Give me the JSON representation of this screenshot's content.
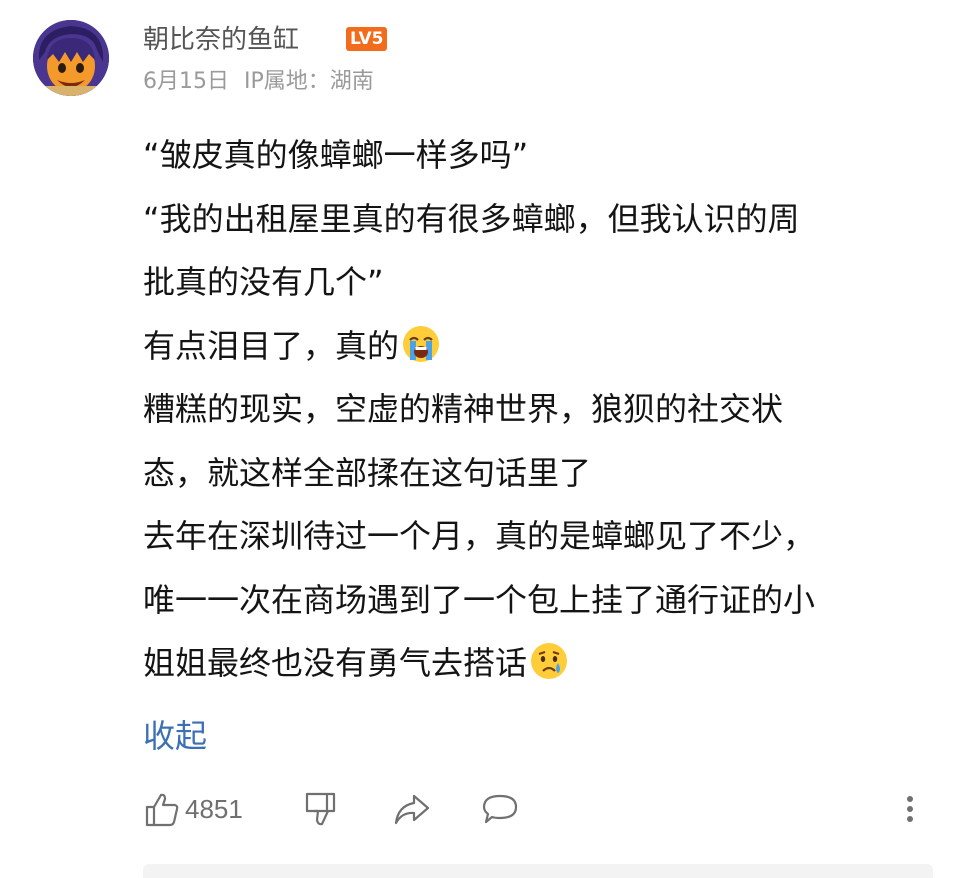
{
  "comment": {
    "user": {
      "name": "朝比奈的鱼缸",
      "level_badge": "LV5"
    },
    "meta": {
      "date": "6月15日",
      "ip_location": "IP属地：湖南"
    },
    "lines": [
      "“皱皮真的像蟑螂一样多吗”",
      "“我的出租屋里真的有很多蟑螂，但我认识的周",
      "批真的没有几个”",
      "有点泪目了，真的",
      "糟糕的现实，空虚的精神世界，狼狈的社交状",
      "态，就这样全部揉在这句话里了",
      "去年在深圳待过一个月，真的是蟑螂见了不少，",
      "唯一一次在商场遇到了一个包上挂了通行证的小",
      "姐姐最终也没有勇气去搭话"
    ],
    "emojis": {
      "line_3": "loudly-crying-face-emoji",
      "line_8": "crying-face-emoji"
    },
    "collapse_label": "收起",
    "actions": {
      "like_icon": "thumbs-up-icon",
      "like_count": "4851",
      "dislike_icon": "thumbs-down-icon",
      "share_icon": "share-icon",
      "reply_icon": "comment-bubble-icon",
      "more_icon": "more-vertical-icon"
    },
    "colors": {
      "badge": "#f26c1c",
      "link": "#3d6fb5",
      "meta_text": "#9a9a9a",
      "icon": "#707070"
    }
  }
}
